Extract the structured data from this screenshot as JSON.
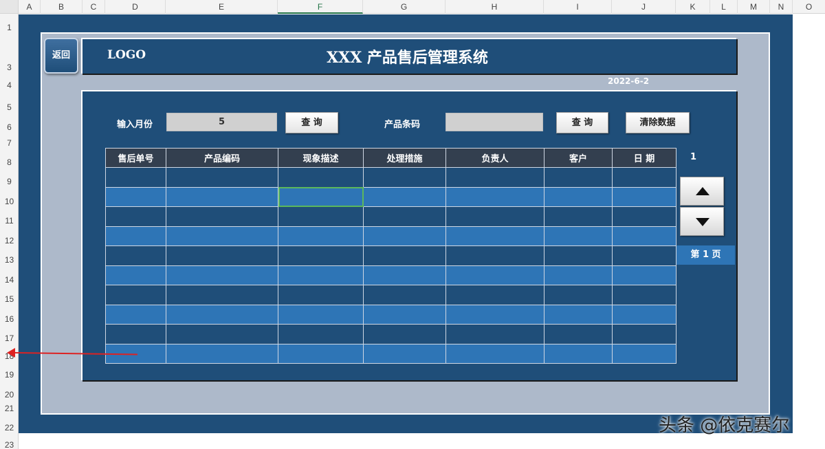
{
  "spreadsheet": {
    "columns": [
      "A",
      "B",
      "C",
      "D",
      "E",
      "F",
      "G",
      "H",
      "I",
      "J",
      "K",
      "L",
      "M",
      "N",
      "O"
    ],
    "rows": [
      "1",
      "3",
      "4",
      "5",
      "6",
      "7",
      "8",
      "9",
      "10",
      "11",
      "12",
      "13",
      "14",
      "15",
      "16",
      "17",
      "18",
      "19",
      "20",
      "21",
      "22",
      "23"
    ]
  },
  "header": {
    "back_label": "返回",
    "logo": "LOGO",
    "title": "XXX 产品售后管理系统",
    "date": "2022-6-2"
  },
  "search": {
    "month_label": "输入月份",
    "month_value": "5",
    "query_label": "查 询",
    "barcode_label": "产品条码",
    "barcode_value": "",
    "query2_label": "查 询",
    "clear_label": "清除数据"
  },
  "table": {
    "headers": [
      "售后单号",
      "产品编码",
      "现象描述",
      "处理措施",
      "负责人",
      "客户",
      "日 期"
    ]
  },
  "pager": {
    "page_number": "1",
    "page_label": "第 1 页"
  },
  "colors": {
    "background": "#1f4e79",
    "header_row": "#333f4f",
    "row_light": "#2e75b6",
    "frame": "#adb9ca"
  },
  "watermark": "头条 @依克赛尔"
}
